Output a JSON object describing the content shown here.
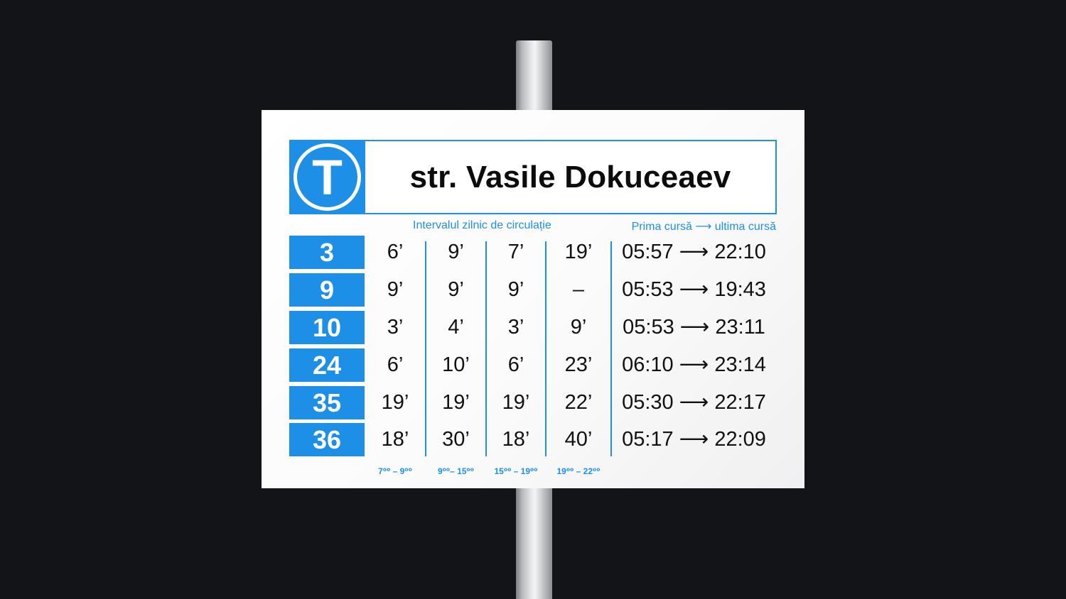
{
  "stop_name": "str. Vasile Dokuceaev",
  "logo_letter": "T",
  "captions": {
    "intervals": "Intervalul zilnic de circulație",
    "first_last": "Prima cursă ⟶ ultima cursă"
  },
  "routes": [
    {
      "number": "3",
      "intervals": [
        "6’",
        "9’",
        "7’",
        "19’"
      ],
      "span": "05:57 ⟶ 22:10"
    },
    {
      "number": "9",
      "intervals": [
        "9’",
        "9’",
        "9’",
        "–"
      ],
      "span": "05:53 ⟶ 19:43"
    },
    {
      "number": "10",
      "intervals": [
        "3’",
        "4’",
        "3’",
        "9’"
      ],
      "span": "05:53 ⟶ 23:11"
    },
    {
      "number": "24",
      "intervals": [
        "6’",
        "10’",
        "6’",
        "23’"
      ],
      "span": "06:10 ⟶ 23:14"
    },
    {
      "number": "35",
      "intervals": [
        "19’",
        "19’",
        "19’",
        "22’"
      ],
      "span": "05:30 ⟶ 22:17"
    },
    {
      "number": "36",
      "intervals": [
        "18’",
        "30’",
        "18’",
        "40’"
      ],
      "span": "05:17 ⟶ 22:09"
    }
  ],
  "time_ranges": [
    "7⁰⁰ – 9⁰⁰",
    "9⁰⁰– 15⁰⁰",
    "15⁰⁰ – 19⁰⁰",
    "19⁰⁰ – 22⁰⁰"
  ],
  "colors": {
    "accent": "#1d8fe6",
    "background": "#131417",
    "sign": "#ffffff",
    "text": "#111111"
  }
}
